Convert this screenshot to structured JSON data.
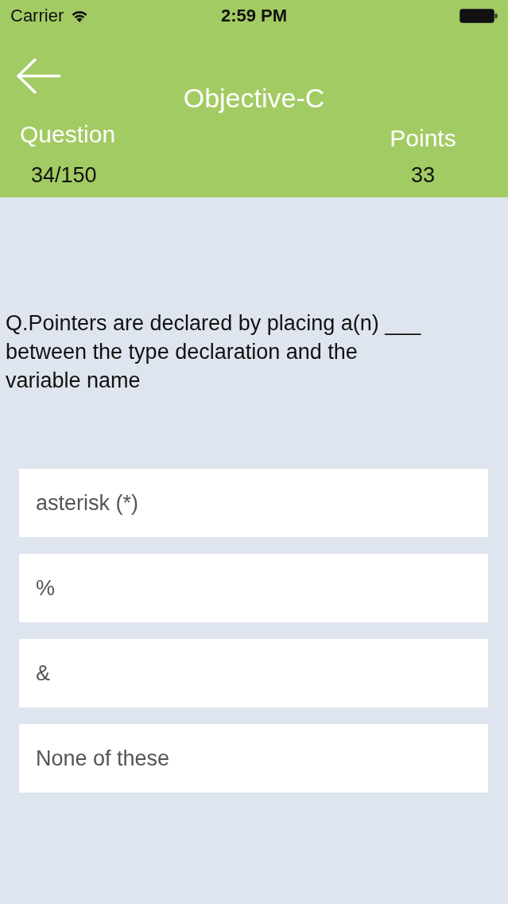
{
  "status_bar": {
    "carrier": "Carrier",
    "time": "2:59 PM"
  },
  "header": {
    "title": "Objective-C",
    "stats": [
      {
        "label": "Question",
        "value": "34/150"
      },
      {
        "label": "Points",
        "value": "33"
      }
    ]
  },
  "question": "Q.Pointers are declared by placing a(n) ___ between the type declaration and the variable name",
  "options": [
    {
      "text": "asterisk (*)"
    },
    {
      "text": "%"
    },
    {
      "text": "&"
    },
    {
      "text": "None of these"
    }
  ]
}
